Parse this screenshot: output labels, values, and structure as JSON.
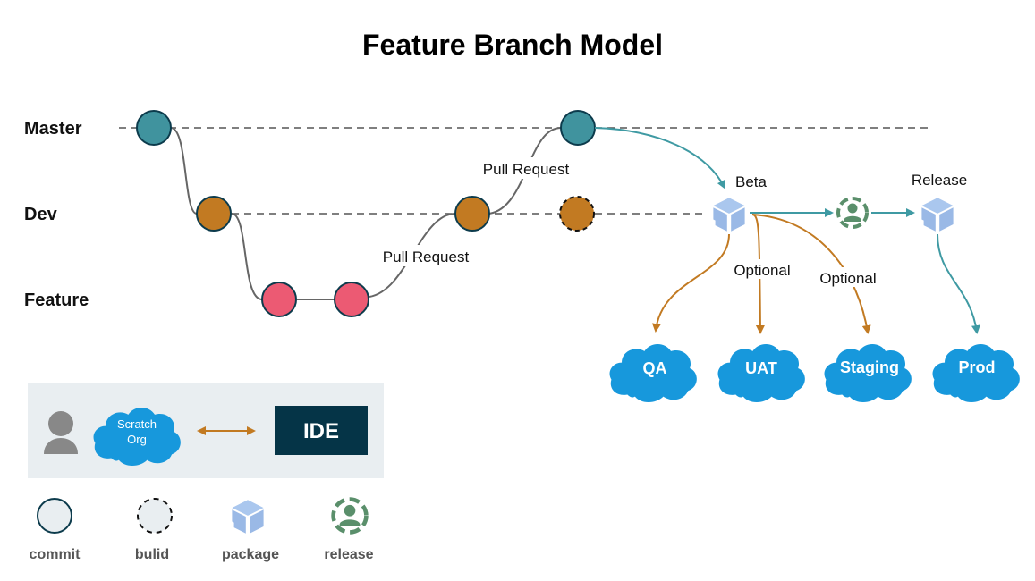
{
  "title": "Feature Branch Model",
  "lanes": [
    {
      "name": "Master"
    },
    {
      "name": "Dev"
    },
    {
      "name": "Feature"
    }
  ],
  "edge_labels": {
    "pr_feature_to_dev": "Pull Request",
    "pr_dev_to_master": "Pull Request",
    "optional_uat": "Optional",
    "optional_staging": "Optional"
  },
  "packages": {
    "beta": "Beta",
    "release": "Release"
  },
  "environments": [
    {
      "name": "QA"
    },
    {
      "name": "UAT"
    },
    {
      "name": "Staging"
    },
    {
      "name": "Prod"
    }
  ],
  "dev_panel": {
    "scratch_org": "Scratch Org",
    "scratch_line1": "Scratch",
    "scratch_line2": "Org",
    "ide": "IDE"
  },
  "legend": [
    {
      "label": "commit",
      "icon": "commit-circle"
    },
    {
      "label": "bulid",
      "icon": "build-dashed-circle"
    },
    {
      "label": "package",
      "icon": "package-cube"
    },
    {
      "label": "release",
      "icon": "release-person"
    }
  ],
  "colors": {
    "master": "#40939e",
    "dev": "#c27a22",
    "feature": "#ec5a73",
    "cloud": "#1798dc",
    "package": "#9ebde8",
    "release": "#5a8f6b",
    "ide_bg": "#053447",
    "panel_bg": "#e9eef1",
    "teal_arrow": "#3f9aa3",
    "orange_arrow": "#c27a22"
  }
}
